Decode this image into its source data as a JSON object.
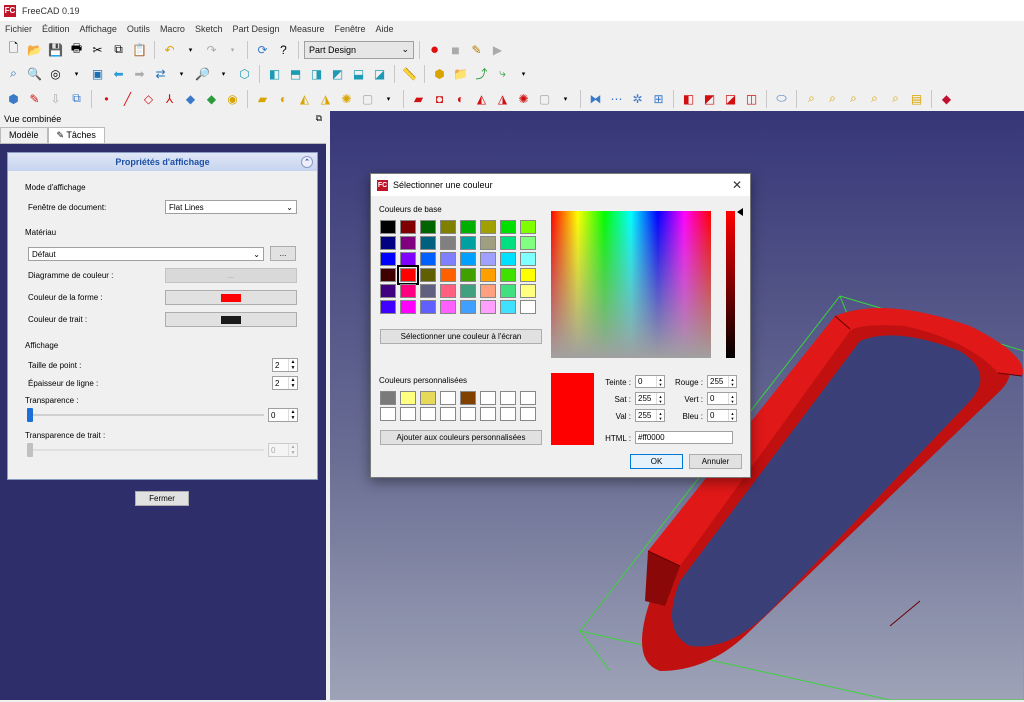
{
  "app": {
    "title": "FreeCAD 0.19",
    "logo": "FC"
  },
  "menu": [
    "Fichier",
    "Édition",
    "Affichage",
    "Outils",
    "Macro",
    "Sketch",
    "Part Design",
    "Measure",
    "Fenêtre",
    "Aide"
  ],
  "toolbar": {
    "workbench": "Part Design"
  },
  "panel": {
    "title": "Vue combinée",
    "tabs": [
      "Modèle",
      "Tâches"
    ],
    "prop_title": "Propriétés d'affichage",
    "mode_section": "Mode d'affichage",
    "doc_window_label": "Fenêtre de document:",
    "doc_window_value": "Flat Lines",
    "material_section": "Matériau",
    "material_value": "Défaut",
    "material_btn": "...",
    "color_diagram_label": "Diagramme de couleur :",
    "color_diagram_btn": "...",
    "shape_color_label": "Couleur de la forme :",
    "shape_color": "#ff0000",
    "line_color_label": "Couleur de trait :",
    "line_color": "#1a1a1a",
    "display_section": "Affichage",
    "point_size_label": "Taille de point :",
    "point_size": "2",
    "line_width_label": "Épaisseur de ligne :",
    "line_width": "2",
    "transparency_label": "Transparence :",
    "transparency": "0",
    "line_transparency_label": "Transparence de trait :",
    "line_transparency": "0",
    "close_btn": "Fermer"
  },
  "dialog": {
    "title": "Sélectionner une couleur",
    "basic_label": "Couleurs de base",
    "basic_colors": [
      "#000000",
      "#800000",
      "#006400",
      "#808000",
      "#00b000",
      "#a0a000",
      "#00e000",
      "#80ff00",
      "#000080",
      "#800080",
      "#006080",
      "#808080",
      "#00a0a0",
      "#a0a080",
      "#00e080",
      "#80ff80",
      "#0000ff",
      "#8000ff",
      "#0060ff",
      "#8080ff",
      "#00a0ff",
      "#a0a0ff",
      "#00e0ff",
      "#80ffff",
      "#400000",
      "#ff0000",
      "#606000",
      "#ff6000",
      "#40a000",
      "#ffa000",
      "#40e000",
      "#ffff00",
      "#400080",
      "#ff0080",
      "#606080",
      "#ff6080",
      "#40a080",
      "#ffa080",
      "#40e080",
      "#ffff80",
      "#4000ff",
      "#ff00ff",
      "#6060ff",
      "#ff60ff",
      "#40a0ff",
      "#ffa0ff",
      "#40e0ff",
      "#ffffff"
    ],
    "pick_screen_btn": "Sélectionner une couleur à l'écran",
    "custom_label": "Couleurs personnalisées",
    "custom_colors": [
      "#7a7a7a",
      "#ffff80",
      "#e6d95a",
      "#ffffff",
      "#804000",
      "#ffffff",
      "#ffffff",
      "#ffffff",
      "#ffffff",
      "#ffffff",
      "#ffffff",
      "#ffffff",
      "#ffffff",
      "#ffffff",
      "#ffffff",
      "#ffffff"
    ],
    "add_custom_btn": "Ajouter aux couleurs personnalisées",
    "hue_label": "Teinte :",
    "hue": "0",
    "sat_label": "Sat :",
    "sat": "255",
    "val_label": "Val :",
    "val": "255",
    "red_label": "Rouge :",
    "red": "255",
    "green_label": "Vert :",
    "green": "0",
    "blue_label": "Bleu :",
    "blue": "0",
    "html_label": "HTML :",
    "html": "#ff0000",
    "ok": "OK",
    "cancel": "Annuler",
    "current_color": "#ff0000"
  }
}
